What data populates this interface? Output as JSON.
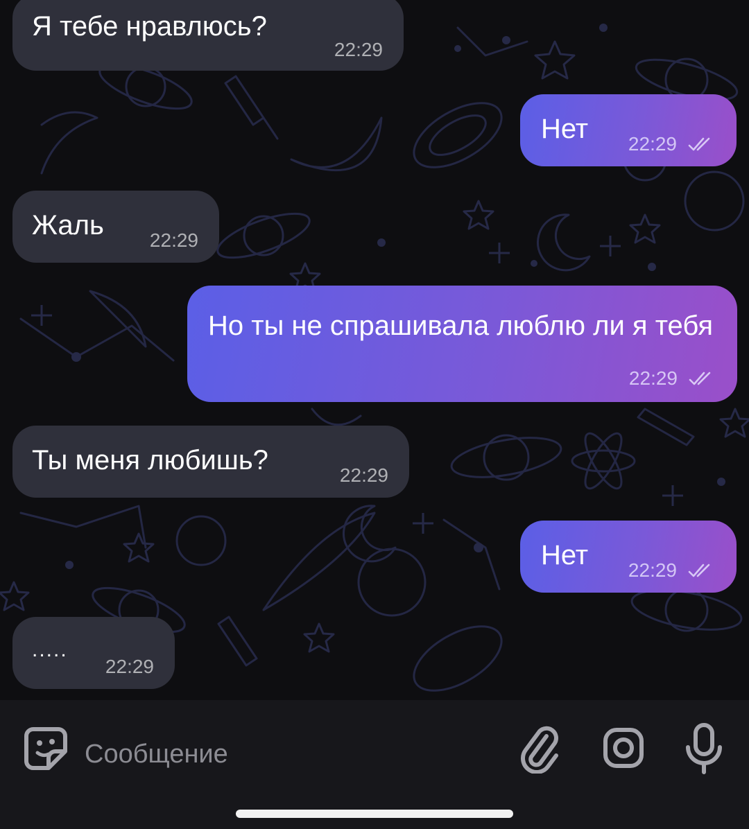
{
  "messages": [
    {
      "direction": "in",
      "text": "Я тебе нравлюсь?",
      "time": "22:29"
    },
    {
      "direction": "out",
      "text": "Нет",
      "time": "22:29",
      "status": "read"
    },
    {
      "direction": "in",
      "text": "Жаль",
      "time": "22:29"
    },
    {
      "direction": "out",
      "text": "Но ты не спрашивала люблю ли я тебя",
      "time": "22:29",
      "status": "read"
    },
    {
      "direction": "in",
      "text": "Ты меня любишь?",
      "time": "22:29"
    },
    {
      "direction": "out",
      "text": "Нет",
      "time": "22:29",
      "status": "read"
    },
    {
      "direction": "in",
      "text": ".....",
      "time": "22:29"
    }
  ],
  "composer": {
    "placeholder": "Сообщение",
    "icons": [
      "sticker-icon",
      "paperclip-icon",
      "camera-icon",
      "microphone-icon"
    ]
  },
  "colors": {
    "incoming_bubble": "#2f303b",
    "outgoing_gradient_start": "#5b5fe6",
    "outgoing_gradient_end": "#9a4fc9",
    "background": "#0e0e11",
    "wallpaper_lines": "#262845"
  }
}
